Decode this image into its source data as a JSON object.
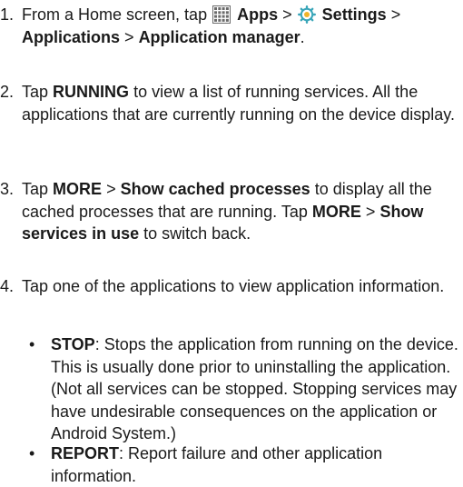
{
  "steps": [
    {
      "num": "1.",
      "t1": "From a Home screen, tap",
      "apps_icon": "apps-grid-icon",
      "apps": "Apps",
      "sep1": ">",
      "settings_icon": "settings-gear-icon",
      "settings": "Settings",
      "sep2": ">",
      "applications": "Applications",
      "sep3": ">",
      "app_manager": "Application manager",
      "end": "."
    },
    {
      "num": "2.",
      "t1": "Tap",
      "running": "RUNNING",
      "t2": "to view a list of running services. All the applications that are currently running on the device display."
    },
    {
      "num": "3.",
      "t1": "Tap",
      "more1": "MORE",
      "sep1": ">",
      "cached": "Show cached processes",
      "t2": "to display all the cached processes that are running. Tap",
      "more2": "MORE",
      "sep2": ">",
      "services": "Show services in use",
      "t3": "to switch back."
    },
    {
      "num": "4.",
      "t1": "Tap one of the applications to view application information."
    }
  ],
  "bullets": [
    {
      "dot": "•",
      "label": "STOP",
      "text": ": Stops the application from running on the device. This is usually done prior to uninstalling the application. (Not all services can be stopped. Stopping services may have undesirable consequences on the application or Android System.)"
    },
    {
      "dot": "•",
      "label": "REPORT",
      "text": ": Report failure and other application information."
    }
  ],
  "colors": {
    "text": "#1a1a1a",
    "icon_gray": "#6b6b6b",
    "gear_teal": "#3aa6b9",
    "gear_yellow": "#f0b429"
  }
}
